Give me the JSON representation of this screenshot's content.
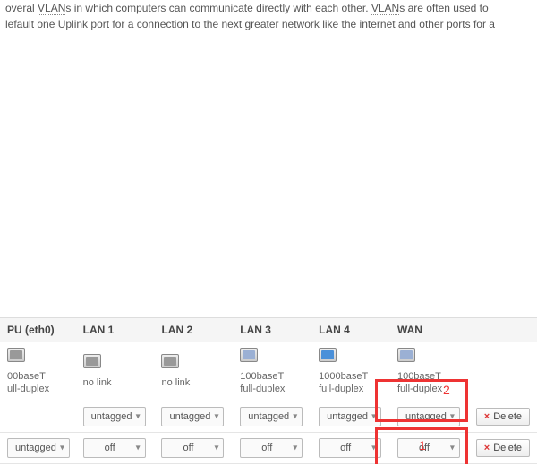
{
  "intro": {
    "line1_pre": "overal ",
    "line1_vlan1": "VLAN",
    "line1_mid": "s in which computers can communicate directly with each other. ",
    "line1_vlan2": "VLAN",
    "line1_post": "s are often used to",
    "line2": "lefault one Uplink port for a connection to the next greater network like the internet and other ports for a"
  },
  "headers": {
    "iface": "PU (eth0)",
    "lan1": "LAN 1",
    "lan2": "LAN 2",
    "lan3": "LAN 3",
    "lan4": "LAN 4",
    "wan": "WAN",
    "actions": ""
  },
  "status": {
    "iface": {
      "speed": "00baseT",
      "duplex": "ull-duplex"
    },
    "lan1": {
      "speed": "no link",
      "duplex": ""
    },
    "lan2": {
      "speed": "no link",
      "duplex": ""
    },
    "lan3": {
      "speed": "100baseT",
      "duplex": "full-duplex"
    },
    "lan4": {
      "speed": "1000baseT",
      "duplex": "full-duplex"
    },
    "wan": {
      "speed": "100baseT",
      "duplex": "full-duplex"
    }
  },
  "rows": [
    {
      "iface": "",
      "lan1": "untagged",
      "lan2": "untagged",
      "lan3": "untagged",
      "lan4": "untagged",
      "wan": "untagged",
      "action": "Delete"
    },
    {
      "iface": "untagged",
      "lan1": "off",
      "lan2": "off",
      "lan3": "off",
      "lan4": "off",
      "wan": "off",
      "action": "Delete"
    }
  ],
  "annotations": {
    "top": "2",
    "bottom": "1"
  }
}
